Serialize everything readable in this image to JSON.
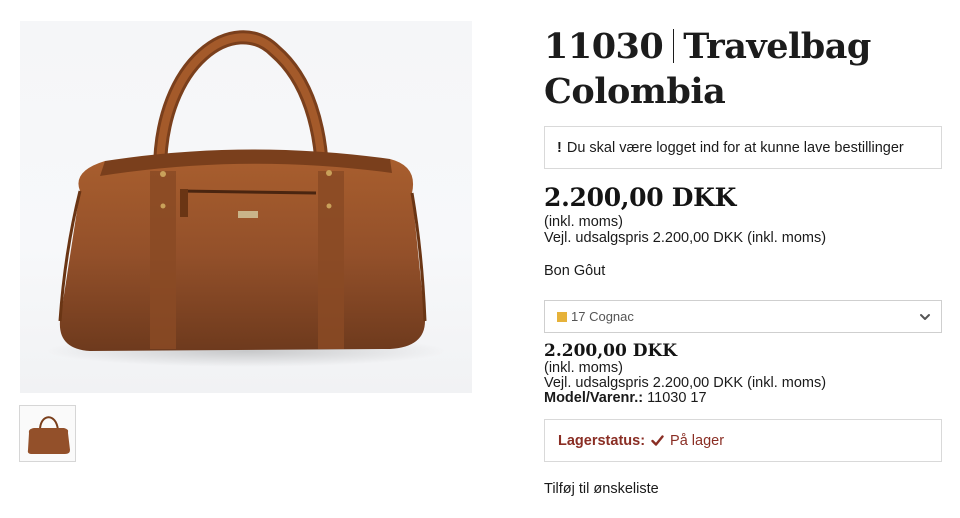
{
  "product": {
    "sku": "11030",
    "name_line1": "Travelbag",
    "name_line2": "Colombia",
    "brand": "Bon Gôut",
    "image_alt": "Travelbag Colombia cognac leather bag"
  },
  "notice": {
    "icon": "exclamation-icon",
    "text": "Du skal være logget ind for at kunne lave bestillinger"
  },
  "price": {
    "main": "2.200,00 DKK",
    "incl_vat": "(inkl. moms)",
    "rrp": "Vejl. udsalgspris 2.200,00 DKK (inkl. moms)"
  },
  "variant_select": {
    "selected": "17 Cognac",
    "swatch_color": "#e6b23a",
    "icon": "chevron-down-icon"
  },
  "variant_price": {
    "main": "2.200,00 DKK",
    "incl_vat": "(inkl. moms)",
    "rrp": "Vejl. udsalgspris 2.200,00 DKK (inkl. moms)",
    "model_label": "Model/Varenr.:",
    "model_value": "11030 17"
  },
  "stock": {
    "label": "Lagerstatus:",
    "icon": "checkmark-icon",
    "value": "På lager",
    "color": "#8a2e24"
  },
  "wishlist": {
    "label": "Tilføj til ønskeliste"
  },
  "colors": {
    "leather": "#8b4a22",
    "accent": "#8a2e24"
  }
}
